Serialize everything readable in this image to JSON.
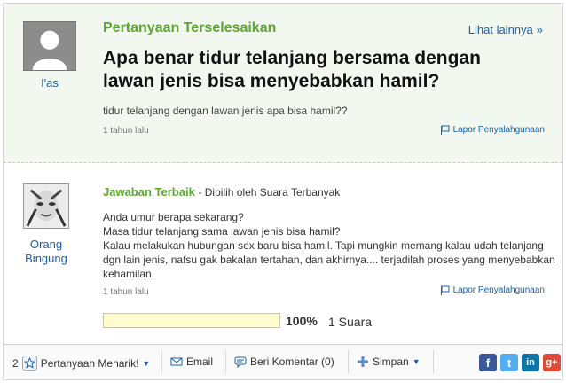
{
  "question": {
    "section_title": "Pertanyaan Terselesaikan",
    "see_more": "Lihat lainnya",
    "see_more_arrow": "»",
    "asker_name": "I'as",
    "title": "Apa benar tidur telanjang bersama dengan lawan jenis bisa menyebabkan hamil?",
    "detail": "tidur telanjang dengan lawan jenis apa bisa hamil??",
    "time": "1 tahun lalu",
    "report": "Lapor Penyalahgunaan"
  },
  "answer": {
    "best_label": "Jawaban Terbaik",
    "chosen_by": "- Dipilih oleh Suara Terbanyak",
    "answerer_name": "Orang Bingung",
    "lines": [
      "Anda umur berapa sekarang?",
      "Masa tidur telanjang sama lawan jenis bisa hamil?",
      "Kalau melakukan hubungan sex baru bisa hamil. Tapi mungkin memang kalau udah telanjang dgn lain jenis, nafsu gak bakalan tertahan, dan akhirnya.... terjadilah proses yang menyebabkan kehamilan."
    ],
    "time": "1 tahun lalu",
    "report": "Lapor Penyalahgunaan",
    "vote_percent": "100%",
    "vote_count": "1 Suara",
    "vote_fraction": 1.0
  },
  "toolbar": {
    "interesting_count": "2",
    "interesting_label": "Pertanyaan Menarik!",
    "email_label": "Email",
    "comment_label": "Beri Komentar (0)",
    "save_label": "Simpan",
    "caret": "▼"
  },
  "social": [
    {
      "icon": "facebook-icon",
      "glyph": "f",
      "color": "#3b5998"
    },
    {
      "icon": "twitter-icon",
      "glyph": "t",
      "color": "#55acee"
    },
    {
      "icon": "linkedin-icon",
      "glyph": "in",
      "color": "#0e76a8"
    },
    {
      "icon": "google-plus-icon",
      "glyph": "g+",
      "color": "#dd4b39"
    }
  ],
  "colors": {
    "accent_green": "#5ca832",
    "link_blue": "#1a5fa8",
    "question_bg": "#f2f8ef",
    "vote_bar": "#fffcd0"
  }
}
